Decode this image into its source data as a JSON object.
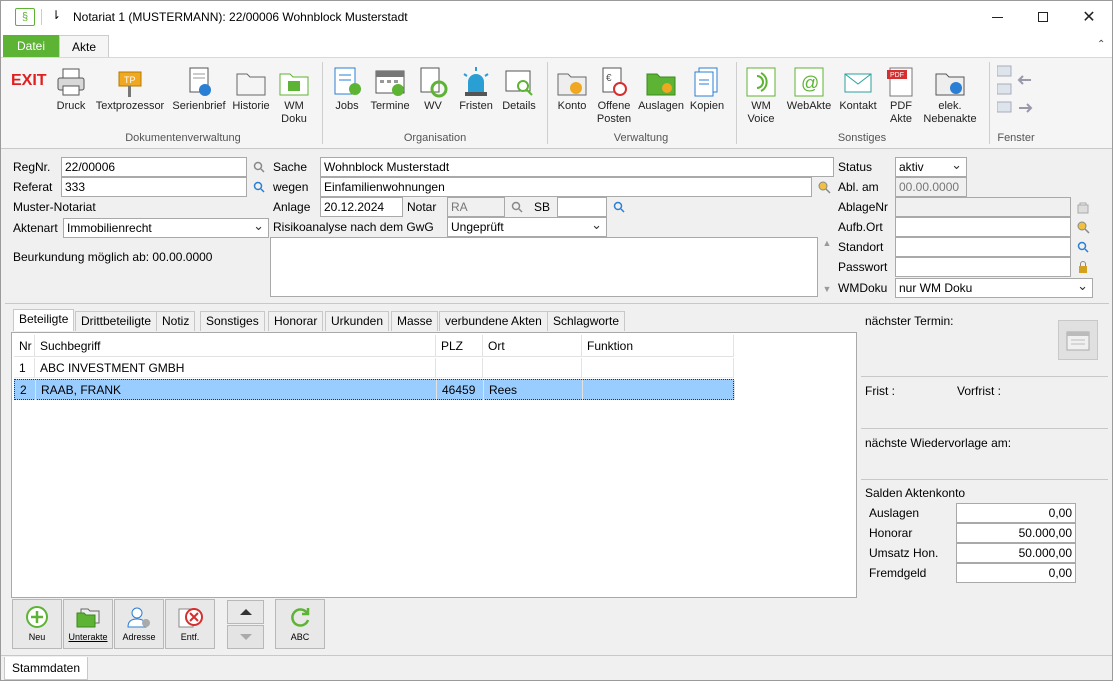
{
  "window": {
    "title": "Notariat 1 (MUSTERMANN): 22/00006 Wohnblock Musterstadt",
    "menu_glyph": "⇂"
  },
  "ribbon_tabs": [
    "Datei",
    "Akte"
  ],
  "ribbon": {
    "exit": "EXIT",
    "buttons": [
      "Druck",
      "Textprozessor",
      "Serienbrief",
      "Historie",
      "WM Doku",
      "Jobs",
      "Termine",
      "WV",
      "Fristen",
      "Details",
      "Konto",
      "Offene Posten",
      "Auslagen",
      "Kopien",
      "WM Voice",
      "WebAkte",
      "Kontakt",
      "PDF Akte",
      "elek. Nebenakte"
    ],
    "groups": [
      "Dokumentenverwaltung",
      "Organisation",
      "Verwaltung",
      "Sonstiges",
      "Fenster"
    ],
    "pdf_badge": "PDF",
    "tp_badge": "TP"
  },
  "form": {
    "regnr_label": "RegNr.",
    "regnr": "22/00006",
    "referat_label": "Referat",
    "referat": "333",
    "office": "Muster-Notariat",
    "aktenart_label": "Aktenart",
    "aktenart": "Immobilienrecht",
    "beurkundung": "Beurkundung möglich ab: 00.00.0000",
    "sache_label": "Sache",
    "sache": "Wohnblock Musterstadt",
    "wegen_label": "wegen",
    "wegen": "Einfamilienwohnungen",
    "anlage_label": "Anlage",
    "anlage": "20.12.2024",
    "notar_label": "Notar",
    "notar": "RA",
    "sb_label": "SB",
    "sb": "",
    "risiko_label": "Risikoanalyse nach dem GwG",
    "risiko": "Ungeprüft",
    "status_label": "Status",
    "status": "aktiv",
    "ablam_label": "Abl. am",
    "ablam": "00.00.0000",
    "ablagenr_label": "AblageNr",
    "aufbort_label": "Aufb.Ort",
    "standort_label": "Standort",
    "passwort_label": "Passwort",
    "wmdoku_label": "WMDoku",
    "wmdoku": "nur WM Doku"
  },
  "tabs": [
    "Beteiligte",
    "Drittbeteiligte",
    "Notiz",
    "Sonstiges",
    "Honorar",
    "Urkunden",
    "Masse",
    "verbundene Akten",
    "Schlagworte"
  ],
  "table": {
    "headers": [
      "Nr",
      "Suchbegriff",
      "PLZ",
      "Ort",
      "Funktion"
    ],
    "rows": [
      [
        "1",
        "ABC INVESTMENT GMBH",
        "",
        "",
        ""
      ],
      [
        "2",
        "RAAB, FRANK",
        "46459",
        "Rees",
        ""
      ]
    ]
  },
  "bottom_buttons": [
    "Neu",
    "Unterakte",
    "Adresse",
    "Entf.",
    "ABC"
  ],
  "right": {
    "naechster_termin": "nächster Termin:",
    "frist": "Frist :",
    "vorfrist": "Vorfrist :",
    "wiedervorlage": "nächste Wiedervorlage am:",
    "salden": "Salden Aktenkonto",
    "auslagen_label": "Auslagen",
    "auslagen": "0,00",
    "honorar_label": "Honorar",
    "honorar": "50.000,00",
    "umsatz_label": "Umsatz Hon.",
    "umsatz": "50.000,00",
    "fremdgeld_label": "Fremdgeld",
    "fremdgeld": "0,00"
  },
  "status_tab": "Stammdaten",
  "colors": {
    "accent_green": "#5db333",
    "selection": "#99ccff",
    "exit_red": "#e02020"
  }
}
